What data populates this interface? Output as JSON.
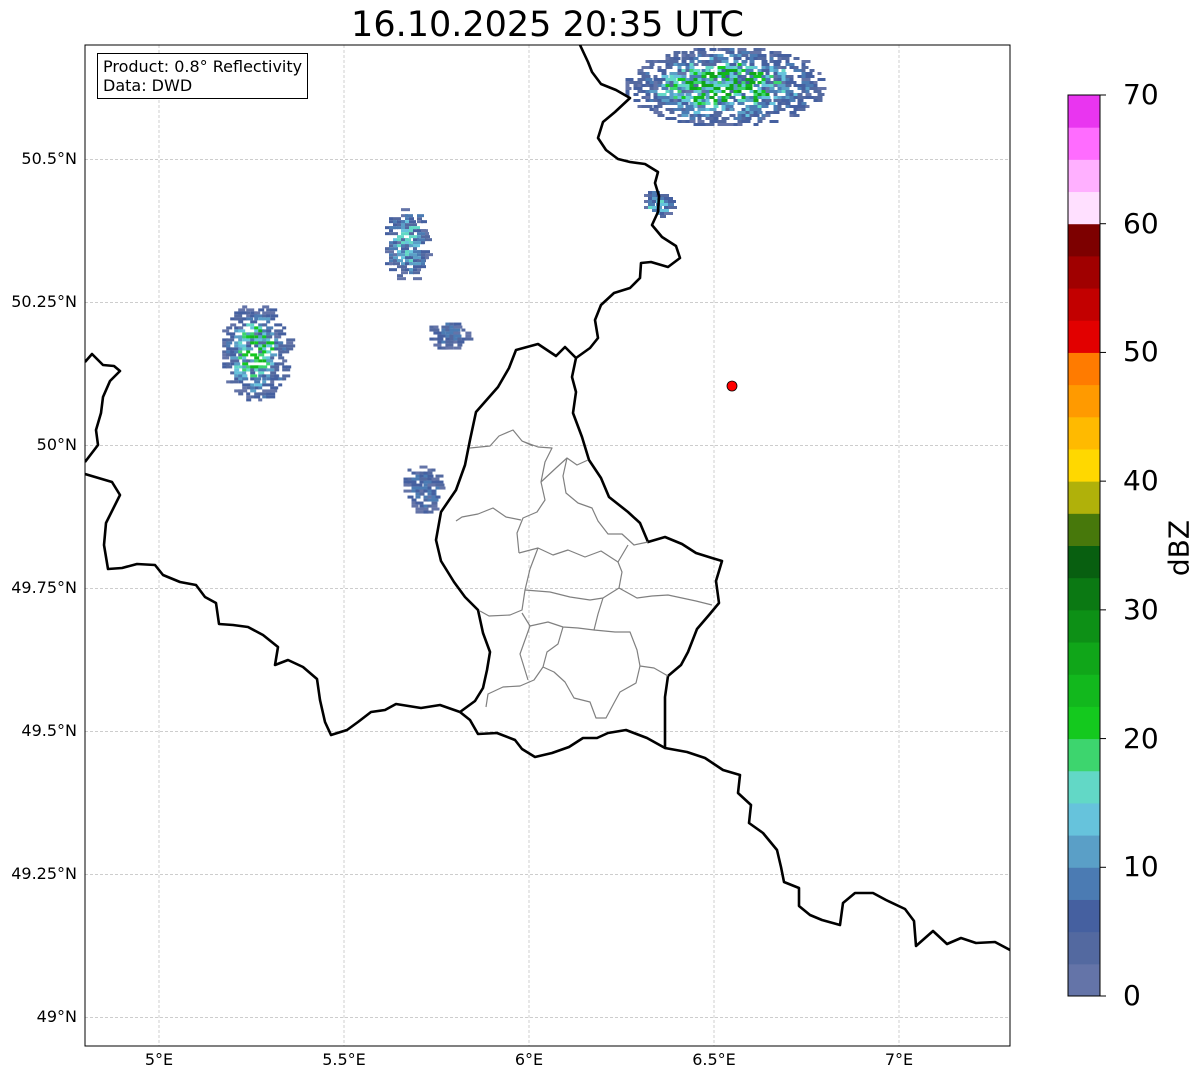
{
  "title": "16.10.2025 20:35 UTC",
  "info": {
    "product": "Product: 0.8° Reflectivity",
    "data": "Data: DWD"
  },
  "map": {
    "lon_range": [
      4.8,
      7.3
    ],
    "lat_range": [
      48.95,
      50.7
    ],
    "lon_ticks": [
      5.0,
      5.5,
      6.0,
      6.5,
      7.0
    ],
    "lon_tick_labels": [
      "5°E",
      "5.5°E",
      "6°E",
      "6.5°E",
      "7°E"
    ],
    "lat_ticks": [
      49.0,
      49.25,
      49.5,
      49.75,
      50.0,
      50.25,
      50.5
    ],
    "lat_tick_labels": [
      "49°N",
      "49.25°N",
      "49.5°N",
      "49.75°N",
      "50°N",
      "50.25°N",
      "50.5°N"
    ],
    "grid": true,
    "radar_site": {
      "lon": 6.55,
      "lat": 50.11,
      "color": "#ff0000"
    },
    "echo_areas": [
      {
        "lon": [
          6.25,
          6.8
        ],
        "lat": [
          50.56,
          50.7
        ],
        "max_dbz": 25
      },
      {
        "lon": [
          5.6,
          5.73
        ],
        "lat": [
          50.29,
          50.42
        ],
        "max_dbz": 15
      },
      {
        "lon": [
          5.16,
          5.35
        ],
        "lat": [
          50.08,
          50.25
        ],
        "max_dbz": 22
      },
      {
        "lon": [
          5.72,
          5.83
        ],
        "lat": [
          50.17,
          50.22
        ],
        "max_dbz": 8
      },
      {
        "lon": [
          5.65,
          5.76
        ],
        "lat": [
          49.88,
          49.97
        ],
        "max_dbz": 8
      },
      {
        "lon": [
          6.3,
          6.38
        ],
        "lat": [
          50.4,
          50.45
        ],
        "max_dbz": 15
      }
    ]
  },
  "colorbar": {
    "label": "dBZ",
    "min": 0,
    "max": 70,
    "tick_values": [
      0,
      10,
      20,
      30,
      40,
      50,
      60,
      70
    ],
    "tick_labels": [
      "0",
      "10",
      "20",
      "30",
      "40",
      "50",
      "60",
      "70"
    ],
    "colors": [
      "#6474a8",
      "#5369a0",
      "#4560a0",
      "#4b7bb3",
      "#5a9fc7",
      "#66c3dc",
      "#62d8c6",
      "#3dd56e",
      "#14c91e",
      "#12b81d",
      "#10a619",
      "#0d9016",
      "#0b7913",
      "#085f10",
      "#47780b",
      "#b0b10a",
      "#ffd800",
      "#ffba00",
      "#ff9a00",
      "#ff7b00",
      "#e20000",
      "#c20000",
      "#a00000",
      "#7d0000",
      "#ffe0ff",
      "#ffb0ff",
      "#ff6cff",
      "#e935f0"
    ]
  }
}
